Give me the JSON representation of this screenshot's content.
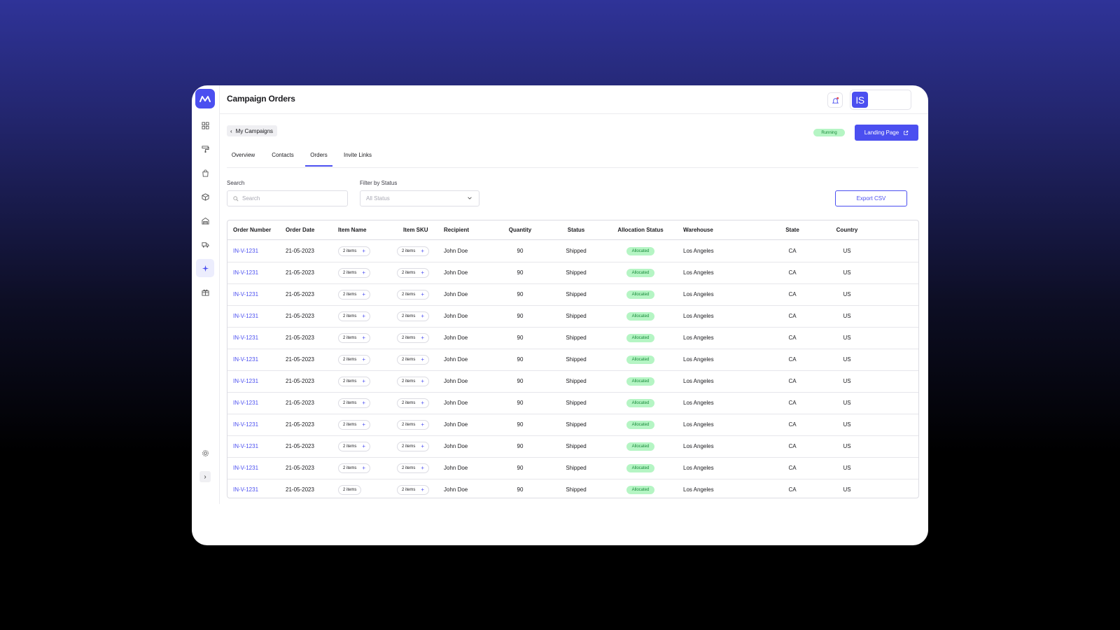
{
  "app": {
    "title": "Campaign Orders",
    "avatar_initials": "IS",
    "accent_color": "#4b4ff0",
    "success_bg": "#b5f5c4",
    "success_text": "#178a39"
  },
  "sidebar": {
    "items": [
      {
        "icon": "dashboard-grid-icon"
      },
      {
        "icon": "paint-roller-icon"
      },
      {
        "icon": "shopping-bag-icon"
      },
      {
        "icon": "package-icon"
      },
      {
        "icon": "warehouse-icon"
      },
      {
        "icon": "truck-icon"
      },
      {
        "icon": "sparkle-icon",
        "active": true
      },
      {
        "icon": "gift-box-icon"
      }
    ],
    "settings_icon": "gear-icon",
    "expand_label": "›"
  },
  "header": {
    "back_label": "My Campaigns",
    "status_badge": "Running",
    "landing_button": "Landing Page"
  },
  "tabs": [
    {
      "label": "Overview",
      "active": false
    },
    {
      "label": "Contacts",
      "active": false
    },
    {
      "label": "Orders",
      "active": true
    },
    {
      "label": "Invite Links",
      "active": false
    }
  ],
  "filters": {
    "search_label": "Search",
    "search_placeholder": "Search",
    "status_label": "Filter by Status",
    "status_value": "All Status",
    "export_button": "Export CSV"
  },
  "table": {
    "columns": [
      "Order Number",
      "Order Date",
      "Item Name",
      "Item SKU",
      "Recipient",
      "Quantity",
      "Status",
      "Allocation Status",
      "Warehouse",
      "State",
      "Country"
    ],
    "rows": [
      {
        "order": "IN-V-1231",
        "date": "21-05-2023",
        "item_name": "2 items",
        "item_name_plus": "+",
        "sku": "2 items",
        "sku_plus": "+",
        "recipient": "John Doe",
        "quantity": "90",
        "status": "Shipped",
        "allocation": "Allocated",
        "warehouse": "Los Angeles",
        "state": "CA",
        "country": "US"
      },
      {
        "order": "IN-V-1231",
        "date": "21-05-2023",
        "item_name": "2 items",
        "item_name_plus": "+",
        "sku": "2 items",
        "sku_plus": "+",
        "recipient": "John Doe",
        "quantity": "90",
        "status": "Shipped",
        "allocation": "Allocated",
        "warehouse": "Los Angeles",
        "state": "CA",
        "country": "US"
      },
      {
        "order": "IN-V-1231",
        "date": "21-05-2023",
        "item_name": "2 items",
        "item_name_plus": "+",
        "sku": "2 items",
        "sku_plus": "+",
        "recipient": "John Doe",
        "quantity": "90",
        "status": "Shipped",
        "allocation": "Allocated",
        "warehouse": "Los Angeles",
        "state": "CA",
        "country": "US"
      },
      {
        "order": "IN-V-1231",
        "date": "21-05-2023",
        "item_name": "2 items",
        "item_name_plus": "+",
        "sku": "2 items",
        "sku_plus": "+",
        "recipient": "John Doe",
        "quantity": "90",
        "status": "Shipped",
        "allocation": "Allocated",
        "warehouse": "Los Angeles",
        "state": "CA",
        "country": "US"
      },
      {
        "order": "IN-V-1231",
        "date": "21-05-2023",
        "item_name": "2 items",
        "item_name_plus": "+",
        "sku": "2 items",
        "sku_plus": "+",
        "recipient": "John Doe",
        "quantity": "90",
        "status": "Shipped",
        "allocation": "Allocated",
        "warehouse": "Los Angeles",
        "state": "CA",
        "country": "US"
      },
      {
        "order": "IN-V-1231",
        "date": "21-05-2023",
        "item_name": "2 items",
        "item_name_plus": "+",
        "sku": "2 items",
        "sku_plus": "+",
        "recipient": "John Doe",
        "quantity": "90",
        "status": "Shipped",
        "allocation": "Allocated",
        "warehouse": "Los Angeles",
        "state": "CA",
        "country": "US"
      },
      {
        "order": "IN-V-1231",
        "date": "21-05-2023",
        "item_name": "2 items",
        "item_name_plus": "+",
        "sku": "2 items",
        "sku_plus": "+",
        "recipient": "John Doe",
        "quantity": "90",
        "status": "Shipped",
        "allocation": "Allocated",
        "warehouse": "Los Angeles",
        "state": "CA",
        "country": "US"
      },
      {
        "order": "IN-V-1231",
        "date": "21-05-2023",
        "item_name": "2 items",
        "item_name_plus": "+",
        "sku": "2 items",
        "sku_plus": "+",
        "recipient": "John Doe",
        "quantity": "90",
        "status": "Shipped",
        "allocation": "Allocated",
        "warehouse": "Los Angeles",
        "state": "CA",
        "country": "US"
      },
      {
        "order": "IN-V-1231",
        "date": "21-05-2023",
        "item_name": "2 items",
        "item_name_plus": "+",
        "sku": "2 items",
        "sku_plus": "+",
        "recipient": "John Doe",
        "quantity": "90",
        "status": "Shipped",
        "allocation": "Allocated",
        "warehouse": "Los Angeles",
        "state": "CA",
        "country": "US"
      },
      {
        "order": "IN-V-1231",
        "date": "21-05-2023",
        "item_name": "2 items",
        "item_name_plus": "+",
        "sku": "2 items",
        "sku_plus": "+",
        "recipient": "John Doe",
        "quantity": "90",
        "status": "Shipped",
        "allocation": "Allocated",
        "warehouse": "Los Angeles",
        "state": "CA",
        "country": "US"
      },
      {
        "order": "IN-V-1231",
        "date": "21-05-2023",
        "item_name": "2 items",
        "item_name_plus": "+",
        "sku": "2 items",
        "sku_plus": "+",
        "recipient": "John Doe",
        "quantity": "90",
        "status": "Shipped",
        "allocation": "Allocated",
        "warehouse": "Los Angeles",
        "state": "CA",
        "country": "US"
      },
      {
        "order": "IN-V-1231",
        "date": "21-05-2023",
        "item_name": "2 items",
        "item_name_plus": "",
        "sku": "2 items",
        "sku_plus": "+",
        "recipient": "John Doe",
        "quantity": "90",
        "status": "Shipped",
        "allocation": "Allocated",
        "warehouse": "Los Angeles",
        "state": "CA",
        "country": "US"
      }
    ]
  }
}
